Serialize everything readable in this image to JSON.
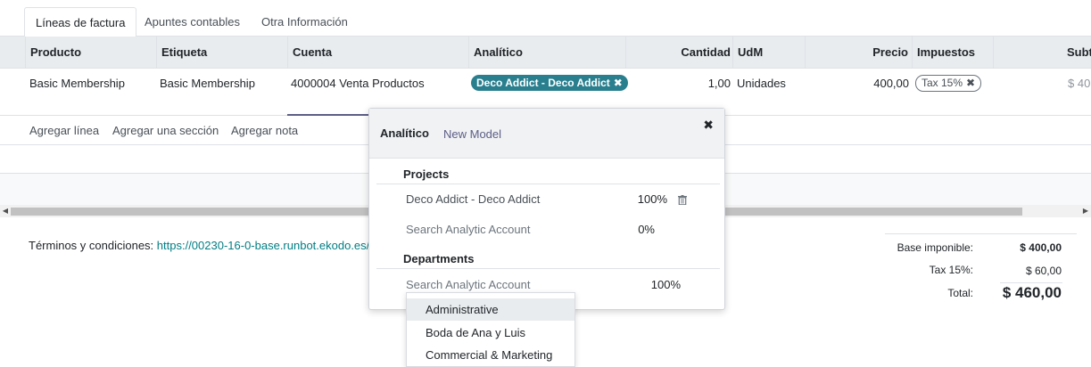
{
  "tabs": [
    {
      "label": "Líneas de factura",
      "active": true
    },
    {
      "label": "Apuntes contables",
      "active": false
    },
    {
      "label": "Otra Información",
      "active": false
    }
  ],
  "table": {
    "columns": [
      "Producto",
      "Etiqueta",
      "Cuenta",
      "Analítico",
      "Cantidad",
      "UdM",
      "Precio",
      "Impuestos",
      "Subt"
    ],
    "row": {
      "producto": "Basic Membership",
      "etiqueta": "Basic Membership",
      "cuenta": "4000004 Venta Productos",
      "analitico": "Deco Addict - Deco Addict",
      "cantidad": "1,00",
      "udm": "Unidades",
      "precio": "400,00",
      "impuestos": "Tax 15%",
      "subtotal": "$ 40"
    }
  },
  "add_links": {
    "line": "Agregar línea",
    "section": "Agregar una sección",
    "note": "Agregar nota"
  },
  "terms": {
    "label": "Términos y condiciones: ",
    "url": "https://00230-16-0-base.runbot.ekodo.es/"
  },
  "totals": {
    "base_label": "Base imponible:",
    "base_value": "$ 400,00",
    "tax_label": "Tax 15%:",
    "tax_value": "$ 60,00",
    "total_label": "Total:",
    "total_value": "$ 460,00"
  },
  "popover": {
    "title": "Analítico",
    "new_model": "New Model",
    "close": "✖",
    "groups": [
      {
        "name": "Projects",
        "lines": [
          {
            "account": "Deco Addict - Deco Addict",
            "percent": "100%",
            "placeholder": false
          },
          {
            "account": "Search Analytic Account",
            "percent": "0%",
            "placeholder": true
          }
        ]
      },
      {
        "name": "Departments",
        "lines": [
          {
            "account": "Search Analytic Account",
            "percent": "100%",
            "placeholder": true
          }
        ]
      }
    ]
  },
  "dropdown": {
    "items": [
      "Administrative",
      "Boda de Ana y Luis",
      "Commercial & Marketing"
    ],
    "highlighted": "Administrative"
  },
  "icons": {
    "tag_remove": "x-icon",
    "trash": "trash-icon",
    "scroll_left": "arrow-left-icon",
    "scroll_right": "arrow-right-icon"
  },
  "colors": {
    "analytic_tag": "#2a7f8f",
    "link": "#017e84",
    "new_model": "#5c5e86",
    "header_bg": "#e9ecef"
  }
}
